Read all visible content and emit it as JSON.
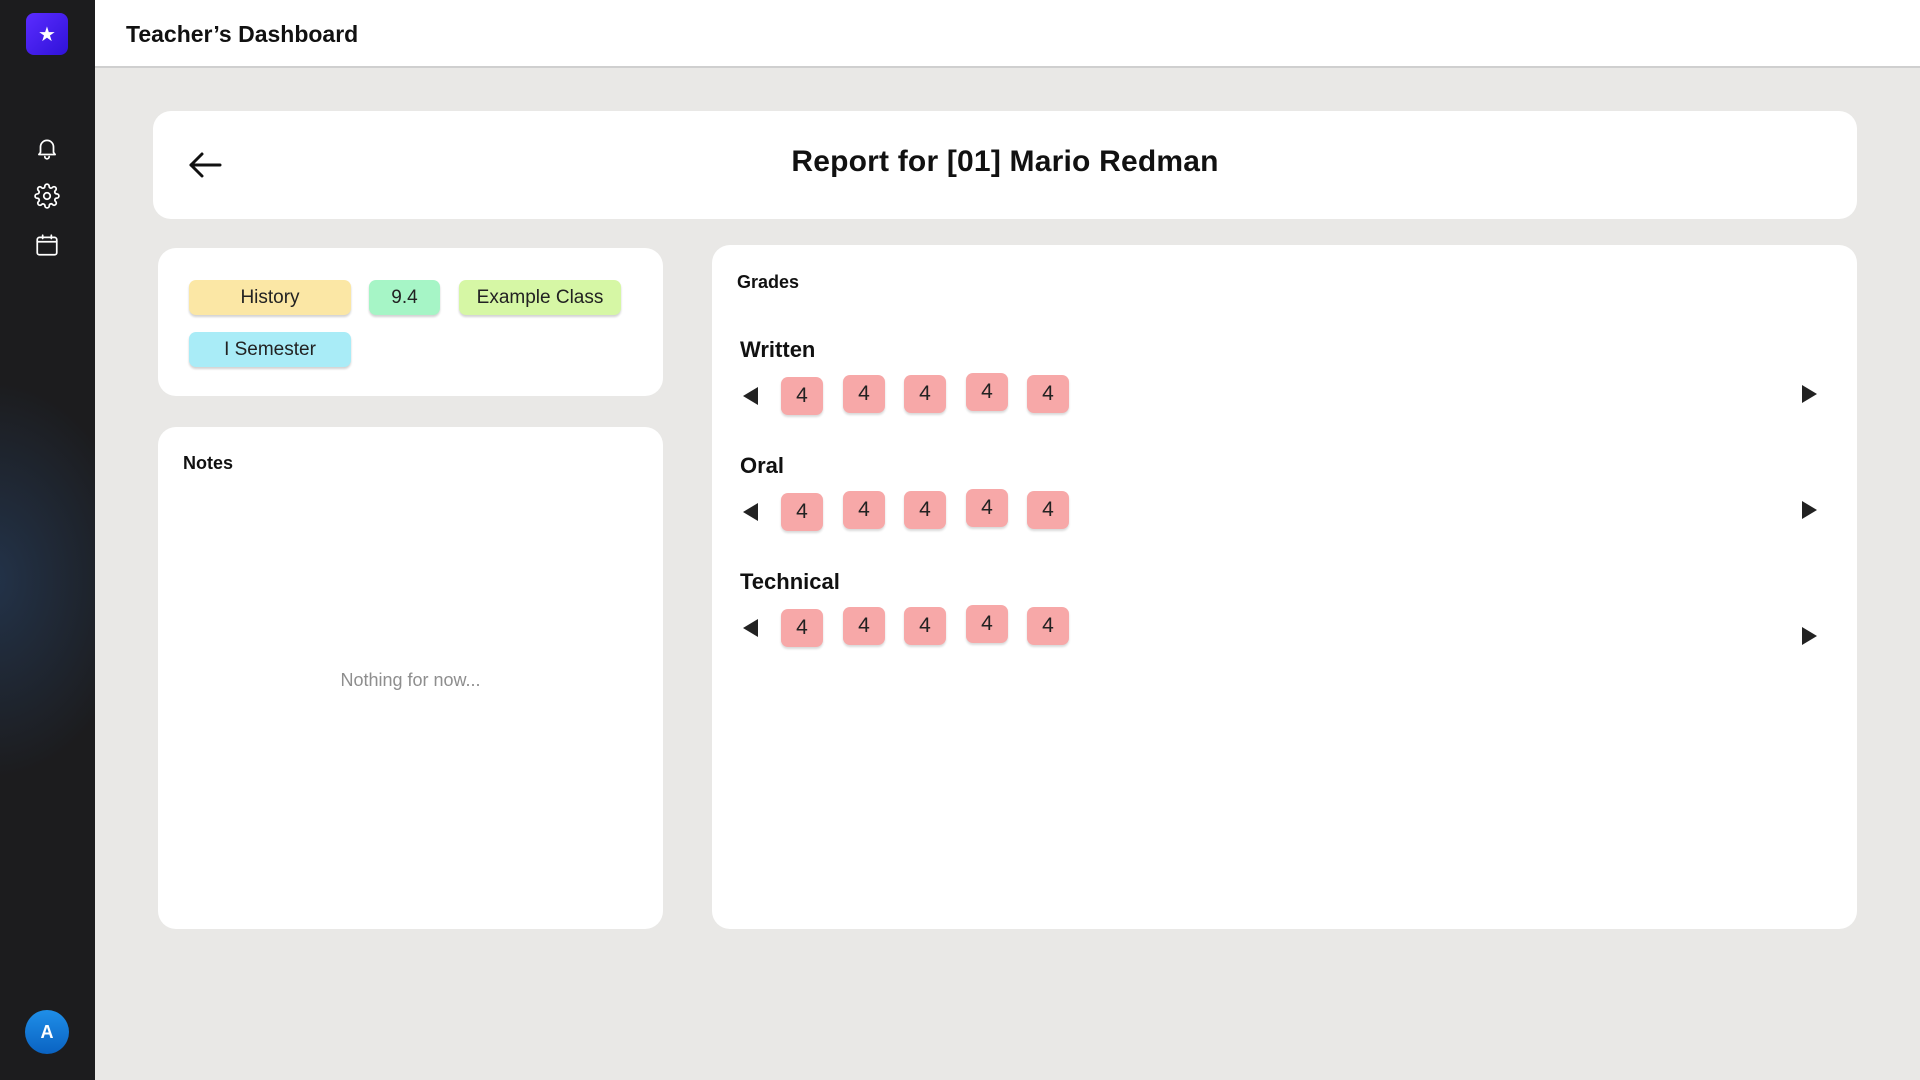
{
  "app": {
    "title": "Teacher’s Dashboard",
    "logo_icon": "star-icon",
    "avatar_initial": "A",
    "accent": "#4a22ee"
  },
  "sidebar": {
    "icons": [
      "bell-icon",
      "gear-icon",
      "calendar-icon"
    ]
  },
  "report": {
    "title": "Report for [01] Mario Redman"
  },
  "tags": [
    {
      "label": "History",
      "color": "#fbe7a5"
    },
    {
      "label": "9.4",
      "color": "#a6f5c6"
    },
    {
      "label": "Example Class",
      "color": "#d6f7a5"
    },
    {
      "label": "I Semester",
      "color": "#a9ecf7"
    }
  ],
  "notes": {
    "heading": "Notes",
    "empty_text": "Nothing for now..."
  },
  "grades": {
    "heading": "Grades",
    "grade_color": "#f7a8a8",
    "categories": [
      {
        "label": "Written",
        "values": [
          "4",
          "4",
          "4",
          "4",
          "4"
        ]
      },
      {
        "label": "Oral",
        "values": [
          "4",
          "4",
          "4",
          "4",
          "4"
        ]
      },
      {
        "label": "Technical",
        "values": [
          "4",
          "4",
          "4",
          "4",
          "4"
        ]
      }
    ]
  }
}
